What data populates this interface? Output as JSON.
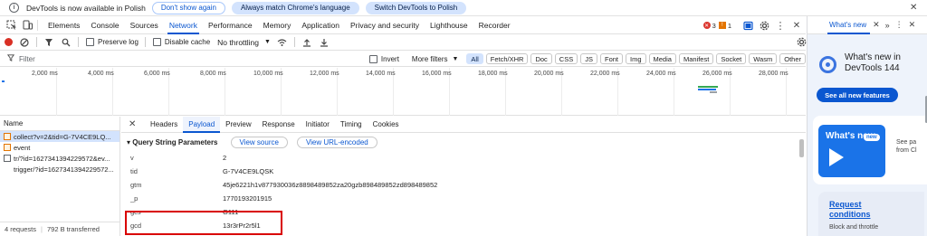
{
  "infobar": {
    "message": "DevTools is now available in Polish",
    "btn_dont_show": "Don't show again",
    "btn_always_match": "Always match Chrome's language",
    "btn_switch": "Switch DevTools to Polish"
  },
  "main_tabs": [
    "Elements",
    "Console",
    "Sources",
    "Network",
    "Performance",
    "Memory",
    "Application",
    "Privacy and security",
    "Lighthouse",
    "Recorder"
  ],
  "active_tab": "Network",
  "badges": {
    "errors": "3",
    "warnings": "1"
  },
  "toolbar": {
    "preserve_log": "Preserve log",
    "disable_cache": "Disable cache",
    "throttling": "No throttling"
  },
  "filter": {
    "placeholder": "Filter",
    "invert": "Invert",
    "more_filters": "More filters",
    "chips": [
      "All",
      "Fetch/XHR",
      "Doc",
      "CSS",
      "JS",
      "Font",
      "Img",
      "Media",
      "Manifest",
      "Socket",
      "Wasm",
      "Other"
    ],
    "active_chip": "All"
  },
  "timeline": {
    "ticks": [
      "2,000 ms",
      "4,000 ms",
      "6,000 ms",
      "8,000 ms",
      "10,000 ms",
      "12,000 ms",
      "14,000 ms",
      "16,000 ms",
      "18,000 ms",
      "20,000 ms",
      "22,000 ms",
      "24,000 ms",
      "26,000 ms",
      "28,000 ms"
    ]
  },
  "request_list": {
    "header": "Name",
    "requests": [
      {
        "name": "collect?v=2&tid=G-7V4CE9LQ...",
        "selected": true
      },
      {
        "name": "event",
        "selected": false
      },
      {
        "name": "tr/?id=1627341394229572&ev...",
        "selected": false
      },
      {
        "name": "trigger/?id=1627341394229572...",
        "selected": false
      }
    ],
    "status_requests": "4 requests",
    "status_transferred": "792 B transferred"
  },
  "details": {
    "tabs": [
      "Headers",
      "Payload",
      "Preview",
      "Response",
      "Initiator",
      "Timing",
      "Cookies"
    ],
    "active_tab": "Payload",
    "section_title": "▾ Query String Parameters",
    "view_source": "View source",
    "view_url_encoded": "View URL-encoded",
    "params": [
      {
        "key": "v",
        "value": "2"
      },
      {
        "key": "tid",
        "value": "G-7V4CE9LQSK"
      },
      {
        "key": "gtm",
        "value": "45je6221h1v877930036z8898489852za20gzb898489852zd898489852"
      },
      {
        "key": "_p",
        "value": "1770193201915"
      },
      {
        "key": "gcs",
        "value": "G111"
      },
      {
        "key": "gcd",
        "value": "13r3rPr2r5l1"
      }
    ]
  },
  "right_panel": {
    "tab_label": "What's new",
    "title": "What's new in DevTools 144",
    "see_all": "See all new features",
    "video_label": "What's new",
    "new_badge": "new",
    "see_past": "See pa\nfrom Cl",
    "request_conditions": "Request conditions",
    "request_conditions_body": "Block and throttle"
  },
  "colors": {
    "accent": "#0b57d0",
    "selection": "#d3e3fd",
    "highlight_box": "#d90000"
  }
}
